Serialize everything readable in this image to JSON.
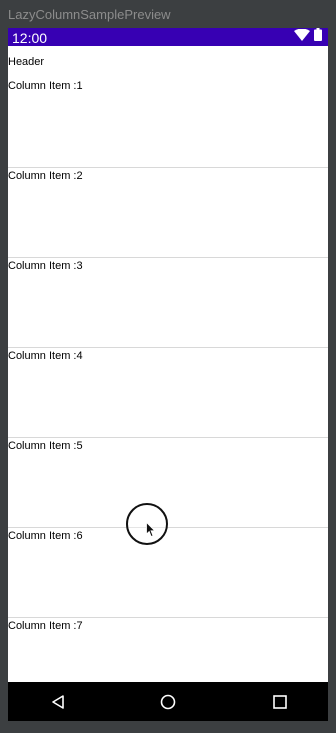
{
  "window": {
    "preview_title": "LazyColumnSamplePreview"
  },
  "status_bar": {
    "time": "12:00",
    "background": "#3700b3",
    "icons": [
      "wifi-icon",
      "battery-icon"
    ]
  },
  "list": {
    "header": "Header",
    "items": [
      "Column Item :1",
      "Column Item :2",
      "Column Item :3",
      "Column Item :4",
      "Column Item :5",
      "Column Item :6",
      "Column Item :7"
    ]
  },
  "navigation_bar": {
    "buttons": [
      "back-icon",
      "home-icon",
      "recents-icon"
    ]
  }
}
